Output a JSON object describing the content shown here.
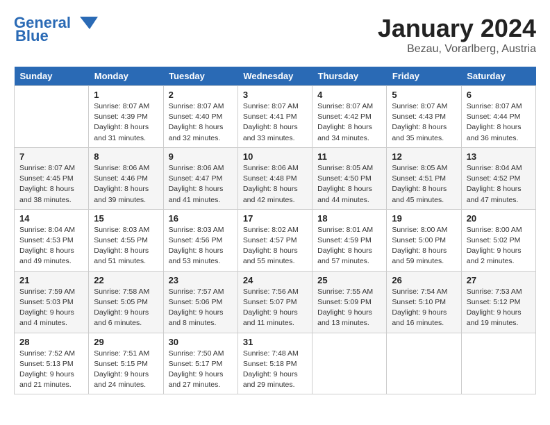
{
  "logo": {
    "line1": "General",
    "line2": "Blue"
  },
  "title": "January 2024",
  "subtitle": "Bezau, Vorarlberg, Austria",
  "days_of_week": [
    "Sunday",
    "Monday",
    "Tuesday",
    "Wednesday",
    "Thursday",
    "Friday",
    "Saturday"
  ],
  "weeks": [
    [
      {
        "num": "",
        "info": ""
      },
      {
        "num": "1",
        "info": "Sunrise: 8:07 AM\nSunset: 4:39 PM\nDaylight: 8 hours\nand 31 minutes."
      },
      {
        "num": "2",
        "info": "Sunrise: 8:07 AM\nSunset: 4:40 PM\nDaylight: 8 hours\nand 32 minutes."
      },
      {
        "num": "3",
        "info": "Sunrise: 8:07 AM\nSunset: 4:41 PM\nDaylight: 8 hours\nand 33 minutes."
      },
      {
        "num": "4",
        "info": "Sunrise: 8:07 AM\nSunset: 4:42 PM\nDaylight: 8 hours\nand 34 minutes."
      },
      {
        "num": "5",
        "info": "Sunrise: 8:07 AM\nSunset: 4:43 PM\nDaylight: 8 hours\nand 35 minutes."
      },
      {
        "num": "6",
        "info": "Sunrise: 8:07 AM\nSunset: 4:44 PM\nDaylight: 8 hours\nand 36 minutes."
      }
    ],
    [
      {
        "num": "7",
        "info": "Sunrise: 8:07 AM\nSunset: 4:45 PM\nDaylight: 8 hours\nand 38 minutes."
      },
      {
        "num": "8",
        "info": "Sunrise: 8:06 AM\nSunset: 4:46 PM\nDaylight: 8 hours\nand 39 minutes."
      },
      {
        "num": "9",
        "info": "Sunrise: 8:06 AM\nSunset: 4:47 PM\nDaylight: 8 hours\nand 41 minutes."
      },
      {
        "num": "10",
        "info": "Sunrise: 8:06 AM\nSunset: 4:48 PM\nDaylight: 8 hours\nand 42 minutes."
      },
      {
        "num": "11",
        "info": "Sunrise: 8:05 AM\nSunset: 4:50 PM\nDaylight: 8 hours\nand 44 minutes."
      },
      {
        "num": "12",
        "info": "Sunrise: 8:05 AM\nSunset: 4:51 PM\nDaylight: 8 hours\nand 45 minutes."
      },
      {
        "num": "13",
        "info": "Sunrise: 8:04 AM\nSunset: 4:52 PM\nDaylight: 8 hours\nand 47 minutes."
      }
    ],
    [
      {
        "num": "14",
        "info": "Sunrise: 8:04 AM\nSunset: 4:53 PM\nDaylight: 8 hours\nand 49 minutes."
      },
      {
        "num": "15",
        "info": "Sunrise: 8:03 AM\nSunset: 4:55 PM\nDaylight: 8 hours\nand 51 minutes."
      },
      {
        "num": "16",
        "info": "Sunrise: 8:03 AM\nSunset: 4:56 PM\nDaylight: 8 hours\nand 53 minutes."
      },
      {
        "num": "17",
        "info": "Sunrise: 8:02 AM\nSunset: 4:57 PM\nDaylight: 8 hours\nand 55 minutes."
      },
      {
        "num": "18",
        "info": "Sunrise: 8:01 AM\nSunset: 4:59 PM\nDaylight: 8 hours\nand 57 minutes."
      },
      {
        "num": "19",
        "info": "Sunrise: 8:00 AM\nSunset: 5:00 PM\nDaylight: 8 hours\nand 59 minutes."
      },
      {
        "num": "20",
        "info": "Sunrise: 8:00 AM\nSunset: 5:02 PM\nDaylight: 9 hours\nand 2 minutes."
      }
    ],
    [
      {
        "num": "21",
        "info": "Sunrise: 7:59 AM\nSunset: 5:03 PM\nDaylight: 9 hours\nand 4 minutes."
      },
      {
        "num": "22",
        "info": "Sunrise: 7:58 AM\nSunset: 5:05 PM\nDaylight: 9 hours\nand 6 minutes."
      },
      {
        "num": "23",
        "info": "Sunrise: 7:57 AM\nSunset: 5:06 PM\nDaylight: 9 hours\nand 8 minutes."
      },
      {
        "num": "24",
        "info": "Sunrise: 7:56 AM\nSunset: 5:07 PM\nDaylight: 9 hours\nand 11 minutes."
      },
      {
        "num": "25",
        "info": "Sunrise: 7:55 AM\nSunset: 5:09 PM\nDaylight: 9 hours\nand 13 minutes."
      },
      {
        "num": "26",
        "info": "Sunrise: 7:54 AM\nSunset: 5:10 PM\nDaylight: 9 hours\nand 16 minutes."
      },
      {
        "num": "27",
        "info": "Sunrise: 7:53 AM\nSunset: 5:12 PM\nDaylight: 9 hours\nand 19 minutes."
      }
    ],
    [
      {
        "num": "28",
        "info": "Sunrise: 7:52 AM\nSunset: 5:13 PM\nDaylight: 9 hours\nand 21 minutes."
      },
      {
        "num": "29",
        "info": "Sunrise: 7:51 AM\nSunset: 5:15 PM\nDaylight: 9 hours\nand 24 minutes."
      },
      {
        "num": "30",
        "info": "Sunrise: 7:50 AM\nSunset: 5:17 PM\nDaylight: 9 hours\nand 27 minutes."
      },
      {
        "num": "31",
        "info": "Sunrise: 7:48 AM\nSunset: 5:18 PM\nDaylight: 9 hours\nand 29 minutes."
      },
      {
        "num": "",
        "info": ""
      },
      {
        "num": "",
        "info": ""
      },
      {
        "num": "",
        "info": ""
      }
    ]
  ]
}
